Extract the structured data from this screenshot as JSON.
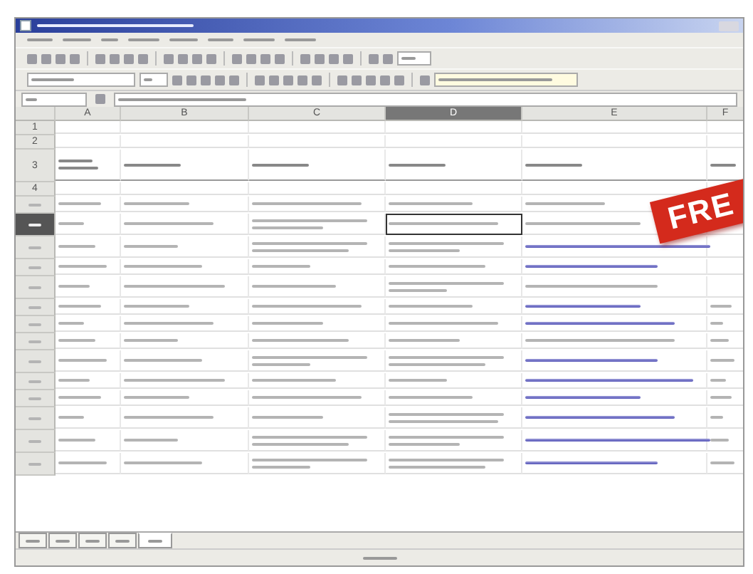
{
  "badge": {
    "text": "FRE"
  },
  "sheet_tabs": [
    {
      "selected": false
    },
    {
      "selected": false
    },
    {
      "selected": false
    },
    {
      "selected": false
    },
    {
      "selected": true
    }
  ],
  "columns": [
    {
      "label": "A",
      "selected": false
    },
    {
      "label": "B",
      "selected": false
    },
    {
      "label": "C",
      "selected": false
    },
    {
      "label": "D",
      "selected": true
    },
    {
      "label": "E",
      "selected": false
    },
    {
      "label": "F",
      "selected": false
    }
  ],
  "rows": [
    {
      "number": "1",
      "selected": false,
      "cells": []
    },
    {
      "number": "2",
      "selected": false,
      "cells": []
    },
    {
      "number": "3",
      "selected": false,
      "cells": [
        {
          "kind": "head"
        },
        {
          "kind": "head"
        },
        {
          "kind": "head"
        },
        {
          "kind": "head"
        },
        {
          "kind": "head"
        },
        {
          "kind": "head"
        }
      ]
    },
    {
      "number": "4",
      "selected": false,
      "cells": []
    },
    {
      "selected": false,
      "cells": [
        {
          "kind": "text"
        },
        {
          "kind": "text"
        },
        {
          "kind": "text"
        },
        {
          "kind": "text"
        },
        {
          "kind": "text"
        },
        {
          "kind": "empty"
        }
      ]
    },
    {
      "selected": true,
      "cells": [
        {
          "kind": "text"
        },
        {
          "kind": "text"
        },
        {
          "kind": "wrap"
        },
        {
          "kind": "text"
        },
        {
          "kind": "text"
        },
        {
          "kind": "empty"
        }
      ]
    },
    {
      "selected": false,
      "cells": [
        {
          "kind": "text"
        },
        {
          "kind": "text"
        },
        {
          "kind": "wrap"
        },
        {
          "kind": "wrap"
        },
        {
          "kind": "link"
        },
        {
          "kind": "empty"
        }
      ]
    },
    {
      "selected": false,
      "cells": [
        {
          "kind": "text"
        },
        {
          "kind": "text"
        },
        {
          "kind": "text"
        },
        {
          "kind": "text"
        },
        {
          "kind": "link"
        },
        {
          "kind": "empty"
        }
      ]
    },
    {
      "selected": false,
      "cells": [
        {
          "kind": "text"
        },
        {
          "kind": "text"
        },
        {
          "kind": "text"
        },
        {
          "kind": "wrap"
        },
        {
          "kind": "text"
        },
        {
          "kind": "empty"
        }
      ]
    },
    {
      "selected": false,
      "cells": [
        {
          "kind": "text"
        },
        {
          "kind": "text"
        },
        {
          "kind": "text"
        },
        {
          "kind": "text"
        },
        {
          "kind": "link"
        },
        {
          "kind": "text"
        }
      ]
    },
    {
      "selected": false,
      "cells": [
        {
          "kind": "text"
        },
        {
          "kind": "text"
        },
        {
          "kind": "text"
        },
        {
          "kind": "text"
        },
        {
          "kind": "link"
        },
        {
          "kind": "text"
        }
      ]
    },
    {
      "selected": false,
      "cells": [
        {
          "kind": "text"
        },
        {
          "kind": "text"
        },
        {
          "kind": "text"
        },
        {
          "kind": "text"
        },
        {
          "kind": "text"
        },
        {
          "kind": "text"
        }
      ]
    },
    {
      "selected": false,
      "cells": [
        {
          "kind": "text"
        },
        {
          "kind": "text"
        },
        {
          "kind": "wrap"
        },
        {
          "kind": "wrap"
        },
        {
          "kind": "link"
        },
        {
          "kind": "text"
        }
      ]
    },
    {
      "selected": false,
      "cells": [
        {
          "kind": "text"
        },
        {
          "kind": "text"
        },
        {
          "kind": "text"
        },
        {
          "kind": "text"
        },
        {
          "kind": "link"
        },
        {
          "kind": "text"
        }
      ]
    },
    {
      "selected": false,
      "cells": [
        {
          "kind": "text"
        },
        {
          "kind": "text"
        },
        {
          "kind": "text"
        },
        {
          "kind": "text"
        },
        {
          "kind": "link"
        },
        {
          "kind": "text"
        }
      ]
    },
    {
      "selected": false,
      "cells": [
        {
          "kind": "text"
        },
        {
          "kind": "text"
        },
        {
          "kind": "text"
        },
        {
          "kind": "wrap"
        },
        {
          "kind": "link"
        },
        {
          "kind": "text"
        }
      ]
    },
    {
      "selected": false,
      "cells": [
        {
          "kind": "text"
        },
        {
          "kind": "text"
        },
        {
          "kind": "wrap"
        },
        {
          "kind": "wrap"
        },
        {
          "kind": "link"
        },
        {
          "kind": "text"
        }
      ]
    },
    {
      "selected": false,
      "cells": [
        {
          "kind": "text"
        },
        {
          "kind": "text"
        },
        {
          "kind": "wrap"
        },
        {
          "kind": "wrap"
        },
        {
          "kind": "link"
        },
        {
          "kind": "text"
        }
      ]
    }
  ]
}
